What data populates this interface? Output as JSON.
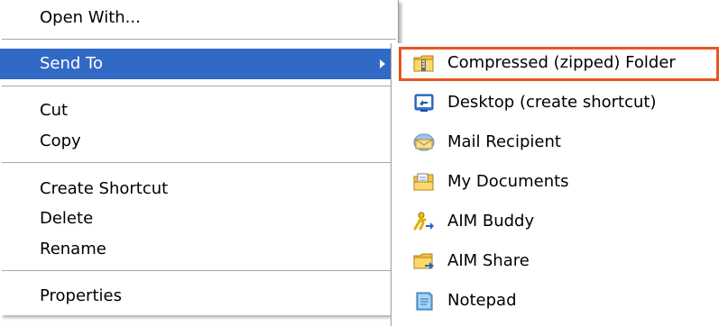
{
  "menu": {
    "items": [
      {
        "label": "Open With..."
      },
      {
        "label": "Send To"
      },
      {
        "label": "Cut"
      },
      {
        "label": "Copy"
      },
      {
        "label": "Create Shortcut"
      },
      {
        "label": "Delete"
      },
      {
        "label": "Rename"
      },
      {
        "label": "Properties"
      }
    ],
    "selected_color": "#316ac5"
  },
  "submenu": {
    "items": [
      {
        "label": "Compressed (zipped) Folder",
        "icon": "zip-folder-icon"
      },
      {
        "label": "Desktop (create shortcut)",
        "icon": "desktop-shortcut-icon"
      },
      {
        "label": "Mail Recipient",
        "icon": "mail-icon"
      },
      {
        "label": "My Documents",
        "icon": "my-documents-icon"
      },
      {
        "label": "AIM Buddy",
        "icon": "aim-buddy-icon"
      },
      {
        "label": "AIM Share",
        "icon": "aim-share-folder-icon"
      },
      {
        "label": "Notepad",
        "icon": "notepad-icon"
      }
    ],
    "highlight_color": "#e8561e"
  }
}
